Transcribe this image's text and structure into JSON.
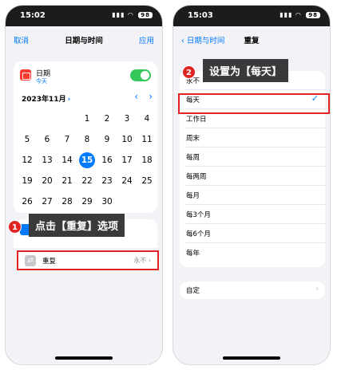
{
  "left_phone": {
    "status": {
      "time": "15:02",
      "signal": "▮▮▮",
      "wifi": "◠",
      "battery": "98"
    },
    "nav": {
      "cancel": "取消",
      "title": "日期与时间",
      "apply": "应用"
    },
    "date_row": {
      "label": "日期",
      "sub": "今天"
    },
    "calendar": {
      "month": "2023年11月",
      "month_chevron": "›",
      "prev": "‹",
      "next": "›",
      "selected_day": "15",
      "weeks": [
        [
          "",
          "",
          "",
          "1",
          "2",
          "3",
          "4"
        ],
        [
          "5",
          "6",
          "7",
          "8",
          "9",
          "10",
          "11"
        ],
        [
          "12",
          "13",
          "14",
          "15",
          "16",
          "17",
          "18"
        ],
        [
          "19",
          "20",
          "21",
          "22",
          "23",
          "24",
          "25"
        ],
        [
          "26",
          "27",
          "28",
          "29",
          "30",
          "",
          ""
        ]
      ]
    },
    "callout": {
      "badge": "1",
      "text": "点击【重复】选项"
    },
    "repeat_row": {
      "label": "重复",
      "value": "永不 ›"
    }
  },
  "right_phone": {
    "status": {
      "time": "15:03",
      "signal": "▮▮▮",
      "wifi": "◠",
      "battery": "98"
    },
    "nav": {
      "back": "‹ 日期与时间",
      "title": "重复"
    },
    "callout": {
      "badge": "2",
      "text": "设置为【每天】"
    },
    "options": [
      "永不",
      "每天",
      "工作日",
      "周末",
      "每周",
      "每两周",
      "每月",
      "每3个月",
      "每6个月",
      "每年"
    ],
    "selected_option": "每天",
    "check": "✓",
    "custom": {
      "label": "自定",
      "chevron": "›"
    }
  },
  "colors": {
    "accent": "#007aff",
    "toggle_on": "#34c759",
    "highlight": "#e02424",
    "callout_bg": "#3a3a3c"
  }
}
